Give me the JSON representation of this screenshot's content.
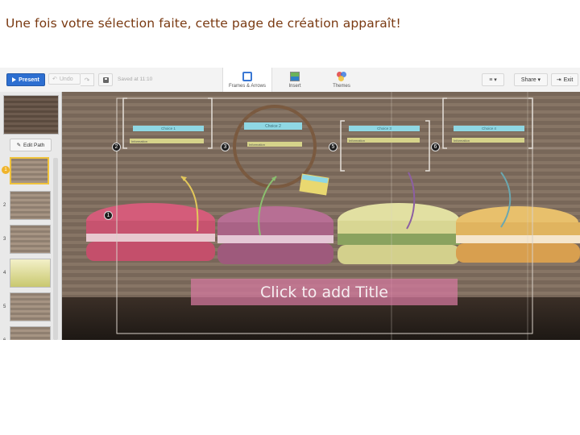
{
  "caption": "Une fois votre sélection faite, cette page de création apparaît!",
  "toolbar": {
    "present_label": "Present",
    "undo_label": "Undo",
    "saved_text": "Saved at 11:10",
    "frames_label": "Frames & Arrows",
    "insert_label": "Insert",
    "themes_label": "Themes",
    "menu_label": "≡ ▾",
    "share_label": "Share ▾",
    "exit_label": "Exit"
  },
  "sidebar": {
    "edit_path_label": "Edit Path",
    "path_numbers": [
      "1",
      "2",
      "3",
      "4",
      "5",
      "6"
    ]
  },
  "canvas": {
    "frames": [
      {
        "label": "Choice 1",
        "text": "Information"
      },
      {
        "label": "Choice 2",
        "text": "Information"
      },
      {
        "label": "Choice 3",
        "text": "Information"
      },
      {
        "label": "Choice 4",
        "text": "Information"
      }
    ],
    "sequence": [
      "1",
      "2",
      "3",
      "5",
      "6"
    ],
    "title_placeholder": "Click to add Title"
  },
  "colors": {
    "accent_blue": "#2d6fd1",
    "frame_label_cyan": "#8fd7e3",
    "text_yellow": "#d6d38a",
    "title_pink": "#d678a0",
    "caption_brown": "#7a3a12"
  }
}
